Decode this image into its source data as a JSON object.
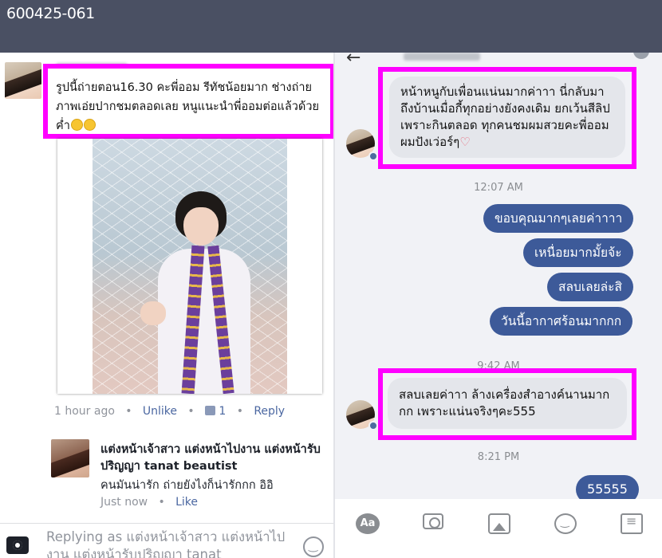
{
  "header": {
    "code": "600425-061"
  },
  "post": {
    "comment_text": "รูปนี้ถ่ายตอน16.30 คะพี่ออม รีทัชน้อยมาก ช่างถ่ายภาพเอ่ยปากชมตลอดเลย หนูแนะนำพี่ออมต่อแล้วด้วยค่ำ",
    "meta": {
      "time": "1 hour ago",
      "unlike": "Unlike",
      "like_count": "1",
      "reply": "Reply"
    }
  },
  "reply": {
    "name": "แต่งหน้าเจ้าสาว แต่งหน้าไปงาน แต่งหน้ารับปริญญา tanat beautist",
    "text": "คนมันน่ารัก ถ่ายยังไงก็น่ารักกก อิอิ",
    "time": "Just now",
    "like": "Like"
  },
  "composer": {
    "placeholder": "Replying as แต่งหน้าเจ้าสาว แต่งหน้าไปงาน แต่งหน้ารับปริญญา tanat"
  },
  "chat": {
    "msg1": "หน้าหนูกับเพื่อนแน่นมากค่าาา นี่กลับมาถึงบ้านเมื่อกี้ทุกอย่างยังคงเดิม ยกเว้นสีลิปเพราะกินตลอด ทุกคนชมผมสวยคะพี่ออม ผมปังเว่อร์ๆ",
    "time1": "12:07 AM",
    "out1": "ขอบคุณมากๆเลยค่าาาา",
    "out2": "เหนื่อยมากมั้ยจ้ะ",
    "out3": "สลบเลยล่ะสิ",
    "out4": "วันนี้อากาศร้อนมากกก",
    "time2": "9:42 AM",
    "msg2": "สลบเลยค่าาา ล้างเครื่องสำอางค์นานมากกก เพราะแน่นจริงๆคะ555",
    "time3": "8:21 PM",
    "out5": "55555"
  },
  "toolbar": {
    "aa": "Aa"
  },
  "colors": {
    "highlight": "#ff00ff",
    "outgoing": "#3d5a99",
    "incoming": "#e4e6eb",
    "topbar": "#4a5063"
  }
}
